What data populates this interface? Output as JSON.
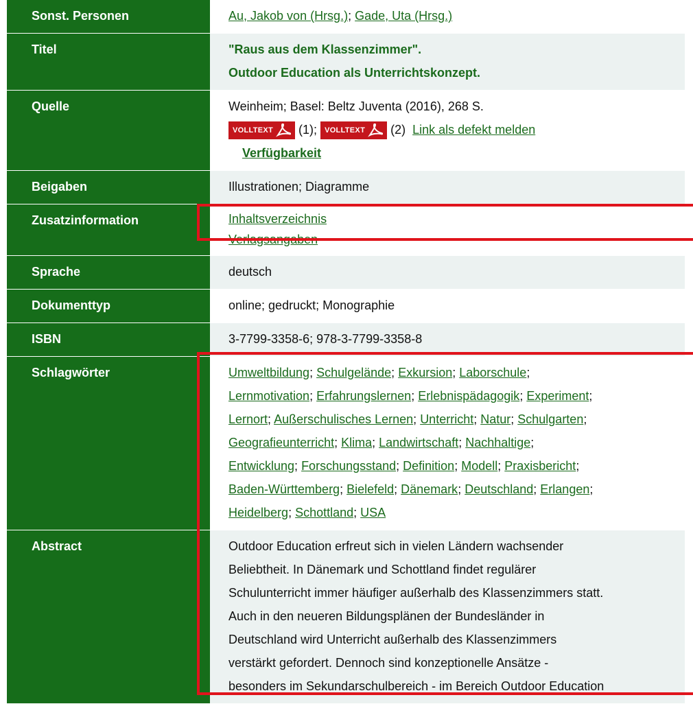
{
  "rows": {
    "personen": {
      "label": "Sonst. Personen",
      "links": [
        "Au, Jakob von (Hrsg.)",
        "Gade, Uta (Hrsg.)"
      ]
    },
    "titel": {
      "label": "Titel",
      "line1": "\"Raus aus dem Klassenzimmer\".",
      "line2": "Outdoor Education als Unterrichtskonzept."
    },
    "quelle": {
      "label": "Quelle",
      "text": "Weinheim; Basel: Beltz Juventa (2016), 268 S.",
      "volltext_badge": "VOLLTEXT",
      "volltext1_suffix": "(1);",
      "volltext2_suffix": "(2)",
      "defekt_link": "Link als defekt melden",
      "verfuegbarkeit": "Verfügbarkeit"
    },
    "beigaben": {
      "label": "Beigaben",
      "value": "Illustrationen; Diagramme"
    },
    "zusatz": {
      "label": "Zusatzinformation",
      "links": [
        "Inhaltsverzeichnis",
        "Verlagsangaben"
      ]
    },
    "sprache": {
      "label": "Sprache",
      "value": "deutsch"
    },
    "dokumenttyp": {
      "label": "Dokumenttyp",
      "value": "online; gedruckt; Monographie"
    },
    "isbn": {
      "label": "ISBN",
      "value": "3-7799-3358-6; 978-3-7799-3358-8"
    },
    "schlagwoerter": {
      "label": "Schlagwörter",
      "lines": [
        [
          "Umweltbildung",
          "Schulgelände",
          "Exkursion",
          "Laborschule"
        ],
        [
          "Lernmotivation",
          "Erfahrungslernen",
          "Erlebnispädagogik",
          "Experiment"
        ],
        [
          "Lernort",
          "Außerschulisches Lernen",
          "Unterricht",
          "Natur",
          "Schulgarten"
        ],
        [
          "Geografieunterricht",
          "Klima",
          "Landwirtschaft",
          "Nachhaltige"
        ],
        [
          "Entwicklung",
          "Forschungsstand",
          "Definition",
          "Modell",
          "Praxisbericht"
        ],
        [
          "Baden-Württemberg",
          "Bielefeld",
          "Dänemark",
          "Deutschland",
          "Erlangen"
        ],
        [
          "Heidelberg",
          "Schottland",
          "USA"
        ]
      ]
    },
    "abstract": {
      "label": "Abstract",
      "lines": [
        "Outdoor Education erfreut sich in vielen Ländern wachsender",
        "Beliebtheit. In Dänemark und Schottland findet regulärer",
        "Schulunterricht immer häufiger außerhalb des Klassenzimmers statt.",
        "Auch in den neueren Bildungsplänen der Bundesländer in",
        "Deutschland wird Unterricht außerhalb des Klassenzimmers",
        "verstärkt gefordert. Dennoch sind konzeptionelle Ansätze -",
        "besonders im Sekundarschulbereich - im Bereich Outdoor Education"
      ]
    }
  },
  "colors": {
    "label_bg": "#166d1a",
    "link": "#1b6b1d",
    "highlight": "#e0141c",
    "pdf_badge": "#c4161c"
  }
}
